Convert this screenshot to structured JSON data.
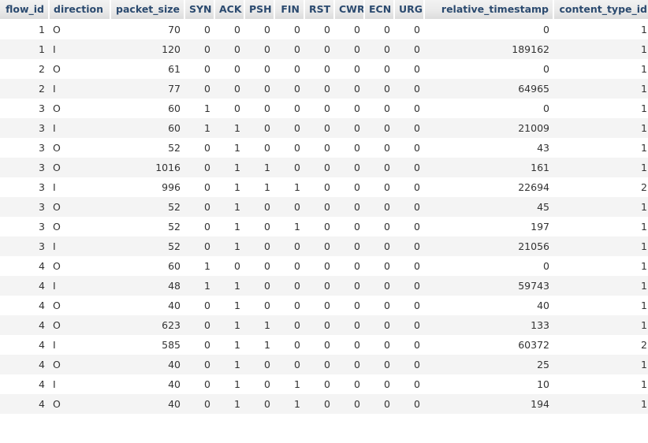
{
  "table": {
    "columns": [
      {
        "key": "flow_id",
        "label": "flow_id",
        "align": "right"
      },
      {
        "key": "direction",
        "label": "direction",
        "align": "left"
      },
      {
        "key": "packet_size",
        "label": "packet_size",
        "align": "right"
      },
      {
        "key": "SYN",
        "label": "SYN",
        "align": "right"
      },
      {
        "key": "ACK",
        "label": "ACK",
        "align": "right"
      },
      {
        "key": "PSH",
        "label": "PSH",
        "align": "right"
      },
      {
        "key": "FIN",
        "label": "FIN",
        "align": "right"
      },
      {
        "key": "RST",
        "label": "RST",
        "align": "right"
      },
      {
        "key": "CWR",
        "label": "CWR",
        "align": "right"
      },
      {
        "key": "ECN",
        "label": "ECN",
        "align": "right"
      },
      {
        "key": "URG",
        "label": "URG",
        "align": "right"
      },
      {
        "key": "relative_timestamp",
        "label": "relative_timestamp",
        "align": "right"
      },
      {
        "key": "content_type_id",
        "label": "content_type_id",
        "align": "right"
      }
    ],
    "rows": [
      {
        "flow_id": "1",
        "direction": "O",
        "packet_size": "70",
        "SYN": "0",
        "ACK": "0",
        "PSH": "0",
        "FIN": "0",
        "RST": "0",
        "CWR": "0",
        "ECN": "0",
        "URG": "0",
        "relative_timestamp": "0",
        "content_type_id": "1"
      },
      {
        "flow_id": "1",
        "direction": "I",
        "packet_size": "120",
        "SYN": "0",
        "ACK": "0",
        "PSH": "0",
        "FIN": "0",
        "RST": "0",
        "CWR": "0",
        "ECN": "0",
        "URG": "0",
        "relative_timestamp": "189162",
        "content_type_id": "1"
      },
      {
        "flow_id": "2",
        "direction": "O",
        "packet_size": "61",
        "SYN": "0",
        "ACK": "0",
        "PSH": "0",
        "FIN": "0",
        "RST": "0",
        "CWR": "0",
        "ECN": "0",
        "URG": "0",
        "relative_timestamp": "0",
        "content_type_id": "1"
      },
      {
        "flow_id": "2",
        "direction": "I",
        "packet_size": "77",
        "SYN": "0",
        "ACK": "0",
        "PSH": "0",
        "FIN": "0",
        "RST": "0",
        "CWR": "0",
        "ECN": "0",
        "URG": "0",
        "relative_timestamp": "64965",
        "content_type_id": "1"
      },
      {
        "flow_id": "3",
        "direction": "O",
        "packet_size": "60",
        "SYN": "1",
        "ACK": "0",
        "PSH": "0",
        "FIN": "0",
        "RST": "0",
        "CWR": "0",
        "ECN": "0",
        "URG": "0",
        "relative_timestamp": "0",
        "content_type_id": "1"
      },
      {
        "flow_id": "3",
        "direction": "I",
        "packet_size": "60",
        "SYN": "1",
        "ACK": "1",
        "PSH": "0",
        "FIN": "0",
        "RST": "0",
        "CWR": "0",
        "ECN": "0",
        "URG": "0",
        "relative_timestamp": "21009",
        "content_type_id": "1"
      },
      {
        "flow_id": "3",
        "direction": "O",
        "packet_size": "52",
        "SYN": "0",
        "ACK": "1",
        "PSH": "0",
        "FIN": "0",
        "RST": "0",
        "CWR": "0",
        "ECN": "0",
        "URG": "0",
        "relative_timestamp": "43",
        "content_type_id": "1"
      },
      {
        "flow_id": "3",
        "direction": "O",
        "packet_size": "1016",
        "SYN": "0",
        "ACK": "1",
        "PSH": "1",
        "FIN": "0",
        "RST": "0",
        "CWR": "0",
        "ECN": "0",
        "URG": "0",
        "relative_timestamp": "161",
        "content_type_id": "1"
      },
      {
        "flow_id": "3",
        "direction": "I",
        "packet_size": "996",
        "SYN": "0",
        "ACK": "1",
        "PSH": "1",
        "FIN": "1",
        "RST": "0",
        "CWR": "0",
        "ECN": "0",
        "URG": "0",
        "relative_timestamp": "22694",
        "content_type_id": "2"
      },
      {
        "flow_id": "3",
        "direction": "O",
        "packet_size": "52",
        "SYN": "0",
        "ACK": "1",
        "PSH": "0",
        "FIN": "0",
        "RST": "0",
        "CWR": "0",
        "ECN": "0",
        "URG": "0",
        "relative_timestamp": "45",
        "content_type_id": "1"
      },
      {
        "flow_id": "3",
        "direction": "O",
        "packet_size": "52",
        "SYN": "0",
        "ACK": "1",
        "PSH": "0",
        "FIN": "1",
        "RST": "0",
        "CWR": "0",
        "ECN": "0",
        "URG": "0",
        "relative_timestamp": "197",
        "content_type_id": "1"
      },
      {
        "flow_id": "3",
        "direction": "I",
        "packet_size": "52",
        "SYN": "0",
        "ACK": "1",
        "PSH": "0",
        "FIN": "0",
        "RST": "0",
        "CWR": "0",
        "ECN": "0",
        "URG": "0",
        "relative_timestamp": "21056",
        "content_type_id": "1"
      },
      {
        "flow_id": "4",
        "direction": "O",
        "packet_size": "60",
        "SYN": "1",
        "ACK": "0",
        "PSH": "0",
        "FIN": "0",
        "RST": "0",
        "CWR": "0",
        "ECN": "0",
        "URG": "0",
        "relative_timestamp": "0",
        "content_type_id": "1"
      },
      {
        "flow_id": "4",
        "direction": "I",
        "packet_size": "48",
        "SYN": "1",
        "ACK": "1",
        "PSH": "0",
        "FIN": "0",
        "RST": "0",
        "CWR": "0",
        "ECN": "0",
        "URG": "0",
        "relative_timestamp": "59743",
        "content_type_id": "1"
      },
      {
        "flow_id": "4",
        "direction": "O",
        "packet_size": "40",
        "SYN": "0",
        "ACK": "1",
        "PSH": "0",
        "FIN": "0",
        "RST": "0",
        "CWR": "0",
        "ECN": "0",
        "URG": "0",
        "relative_timestamp": "40",
        "content_type_id": "1"
      },
      {
        "flow_id": "4",
        "direction": "O",
        "packet_size": "623",
        "SYN": "0",
        "ACK": "1",
        "PSH": "1",
        "FIN": "0",
        "RST": "0",
        "CWR": "0",
        "ECN": "0",
        "URG": "0",
        "relative_timestamp": "133",
        "content_type_id": "1"
      },
      {
        "flow_id": "4",
        "direction": "I",
        "packet_size": "585",
        "SYN": "0",
        "ACK": "1",
        "PSH": "1",
        "FIN": "0",
        "RST": "0",
        "CWR": "0",
        "ECN": "0",
        "URG": "0",
        "relative_timestamp": "60372",
        "content_type_id": "2"
      },
      {
        "flow_id": "4",
        "direction": "O",
        "packet_size": "40",
        "SYN": "0",
        "ACK": "1",
        "PSH": "0",
        "FIN": "0",
        "RST": "0",
        "CWR": "0",
        "ECN": "0",
        "URG": "0",
        "relative_timestamp": "25",
        "content_type_id": "1"
      },
      {
        "flow_id": "4",
        "direction": "I",
        "packet_size": "40",
        "SYN": "0",
        "ACK": "1",
        "PSH": "0",
        "FIN": "1",
        "RST": "0",
        "CWR": "0",
        "ECN": "0",
        "URG": "0",
        "relative_timestamp": "10",
        "content_type_id": "1"
      },
      {
        "flow_id": "4",
        "direction": "O",
        "packet_size": "40",
        "SYN": "0",
        "ACK": "1",
        "PSH": "0",
        "FIN": "1",
        "RST": "0",
        "CWR": "0",
        "ECN": "0",
        "URG": "0",
        "relative_timestamp": "194",
        "content_type_id": "1"
      }
    ]
  },
  "colors": {
    "header_text": "#2b4a6f",
    "header_bg": "#eaeaea",
    "row_stripe": "#f4f4f4",
    "cell_text": "#333333"
  }
}
